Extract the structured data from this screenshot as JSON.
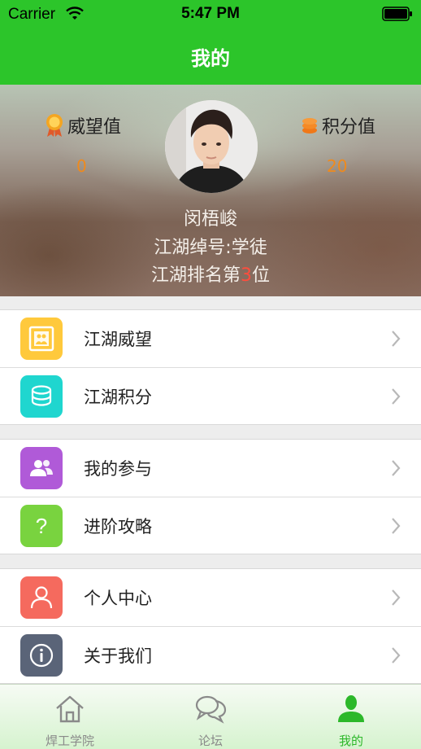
{
  "status_bar": {
    "carrier": "Carrier",
    "time": "5:47 PM"
  },
  "nav": {
    "title": "我的"
  },
  "profile": {
    "prestige": {
      "label": "威望值",
      "value": "0",
      "icon": "medal-icon"
    },
    "points": {
      "label": "积分值",
      "value": "20",
      "icon": "coin-stack-icon"
    },
    "name": "闵梧峻",
    "rank_title": "江湖绰号:学徒",
    "rank_prefix": "江湖排名第",
    "rank_number": "3",
    "rank_suffix": "位"
  },
  "menu": {
    "group1": [
      {
        "label": "江湖威望",
        "icon": "photo-frame-icon",
        "color": "#ffc93c"
      },
      {
        "label": "江湖积分",
        "icon": "coins-icon",
        "color": "#1fd6cf"
      }
    ],
    "group2": [
      {
        "label": "我的参与",
        "icon": "users-icon",
        "color": "#b05ad8"
      },
      {
        "label": "进阶攻略",
        "icon": "question-icon",
        "color": "#79d33f"
      }
    ],
    "group3": [
      {
        "label": "个人中心",
        "icon": "person-icon",
        "color": "#f56a5e"
      },
      {
        "label": "关于我们",
        "icon": "info-icon",
        "color": "#5a6478"
      }
    ]
  },
  "tabs": [
    {
      "label": "焊工学院",
      "icon": "home-icon",
      "active": false
    },
    {
      "label": "论坛",
      "icon": "chat-bubbles-icon",
      "active": false
    },
    {
      "label": "我的",
      "icon": "user-silhouette-icon",
      "active": true
    }
  ],
  "colors": {
    "brand_green": "#2cc52a",
    "value_orange": "#f08a1c",
    "rank_red": "#ff4d3d"
  }
}
